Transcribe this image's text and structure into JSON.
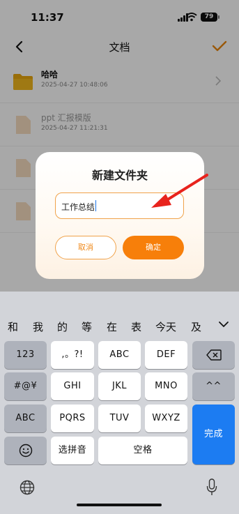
{
  "status_bar": {
    "time": "11:37",
    "battery": "79"
  },
  "nav": {
    "title": "文档"
  },
  "files": [
    {
      "name": "哈哈",
      "date": "2025-04-27 10:48:06"
    },
    {
      "name": "ppt 汇报模版",
      "date": "2025-04-27 11:21:31"
    }
  ],
  "dialog": {
    "title": "新建文件夹",
    "input_value": "工作总结",
    "cancel_label": "取消",
    "confirm_label": "确定"
  },
  "keyboard": {
    "candidates": [
      "和",
      "我",
      "的",
      "等",
      "在",
      "表",
      "今天",
      "及"
    ],
    "row1": [
      "123",
      ",。?!",
      "ABC",
      "DEF"
    ],
    "row2": [
      "#@¥",
      "GHI",
      "JKL",
      "MNO",
      "^^"
    ],
    "row3": [
      "ABC",
      "PQRS",
      "TUV",
      "WXYZ"
    ],
    "done_label": "完成",
    "pinyin_label": "选拼音",
    "space_label": "空格"
  },
  "colors": {
    "accent": "#f77f0a",
    "done_key": "#1c7cf2",
    "folder": "#e8a70e"
  },
  "icons": [
    "back-icon",
    "checkmark-icon",
    "folder-icon",
    "document-icon",
    "chevron-right-icon",
    "backspace-icon",
    "emoji-icon",
    "globe-icon",
    "microphone-icon",
    "keyboard-collapse-icon"
  ]
}
